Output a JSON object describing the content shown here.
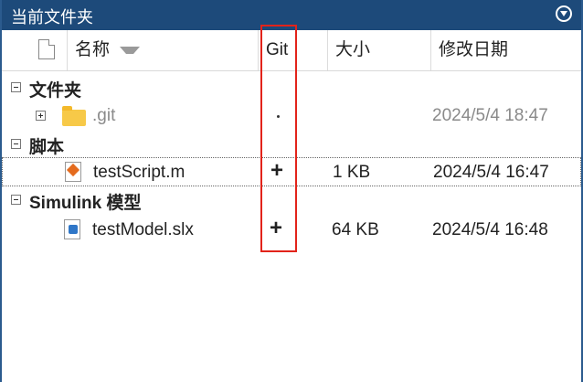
{
  "panel": {
    "title": "当前文件夹"
  },
  "columns": {
    "name": "名称",
    "git": "Git",
    "size": "大小",
    "modified": "修改日期"
  },
  "groups": [
    {
      "label": "文件夹",
      "items": [
        {
          "name": ".git",
          "git": "·",
          "size": "",
          "modified": "2024/5/4 18:47"
        }
      ]
    },
    {
      "label": "脚本",
      "items": [
        {
          "name": "testScript.m",
          "git": "+",
          "size": "1 KB",
          "modified": "2024/5/4 16:47"
        }
      ]
    },
    {
      "label": "Simulink 模型",
      "items": [
        {
          "name": "testModel.slx",
          "git": "+",
          "size": "64 KB",
          "modified": "2024/5/4 16:48"
        }
      ]
    }
  ]
}
